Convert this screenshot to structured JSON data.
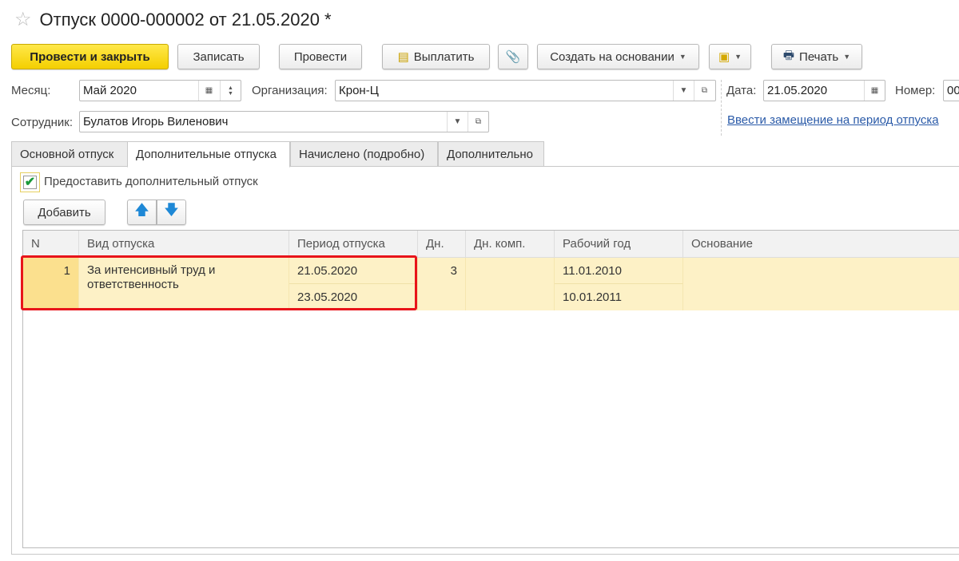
{
  "title": "Отпуск 0000-000002 от 21.05.2020 *",
  "toolbar": {
    "post_close": "Провести и закрыть",
    "save": "Записать",
    "post": "Провести",
    "pay": "Выплатить",
    "create_based": "Создать на основании",
    "print": "Печать"
  },
  "form": {
    "month_label": "Месяц:",
    "month_value": "Май 2020",
    "org_label": "Организация:",
    "org_value": "Крон-Ц",
    "date_label": "Дата:",
    "date_value": "21.05.2020",
    "number_label": "Номер:",
    "number_value": "00",
    "employee_label": "Сотрудник:",
    "employee_value": "Булатов Игорь Виленович",
    "substitute_link": "Ввести замещение на период отпуска"
  },
  "tabs": [
    "Основной отпуск",
    "Дополнительные отпуска",
    "Начислено (подробно)",
    "Дополнительно"
  ],
  "checkbox": {
    "label": "Предоставить дополнительный отпуск",
    "checked": true
  },
  "table": {
    "add": "Добавить",
    "columns": [
      "N",
      "Вид отпуска",
      "Период отпуска",
      "Дн.",
      "Дн. комп.",
      "Рабочий год",
      "Основание"
    ],
    "rows": [
      {
        "n": "1",
        "type": "За интенсивный труд и ответственность",
        "period_from": "21.05.2020",
        "period_to": "23.05.2020",
        "days": "3",
        "comp_days": "",
        "year_from": "11.01.2010",
        "year_to": "10.01.2011",
        "basis": ""
      }
    ]
  }
}
